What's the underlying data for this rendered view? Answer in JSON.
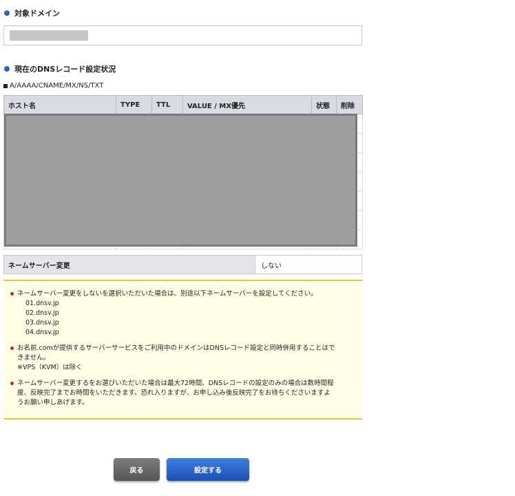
{
  "target_domain": {
    "title": "対象ドメイン"
  },
  "dns_status": {
    "title": "現在のDNSレコード設定状況",
    "record_types": "A/AAAA/CNAME/MX/NS/TXT",
    "columns": [
      "ホスト名",
      "TYPE",
      "TTL",
      "VALUE / MX優先",
      "状態",
      "削除"
    ]
  },
  "nameserver_change": {
    "label": "ネームサーバー変更",
    "value": "しない"
  },
  "notices": {
    "n1": "ネームサーバー変更をしないを選択いただいた場合は、別途以下ネームサーバーを設定してください。",
    "servers": [
      "01.dnsv.jp",
      "02.dnsv.jp",
      "03.dnsv.jp",
      "04.dnsv.jp"
    ],
    "n2_line1": "お名前.comが提供するサーバーサービスをご利用中のドメインはDNSレコード設定と同時併用することはで",
    "n2_line2": "きません。",
    "n2_line3": "※VPS（KVM）は除く",
    "n3_line1": "ネームサーバー変更するをお選びいただいた場合は最大72時間、DNSレコードの設定のみの場合は数時間程",
    "n3_line2": "度、反映完了までお時間をいただきます。恐れ入りますが、お申し込み後反映完了をお待ちくださいますよ",
    "n3_line3": "うお願い申しあげます。"
  },
  "buttons": {
    "back": "戻る",
    "submit": "設定する"
  },
  "colors": {
    "accent_blue": "#2a66c4",
    "notice_border": "#e9c62b",
    "notice_bg": "#fffee6",
    "bullet_red": "#d11f1f"
  }
}
